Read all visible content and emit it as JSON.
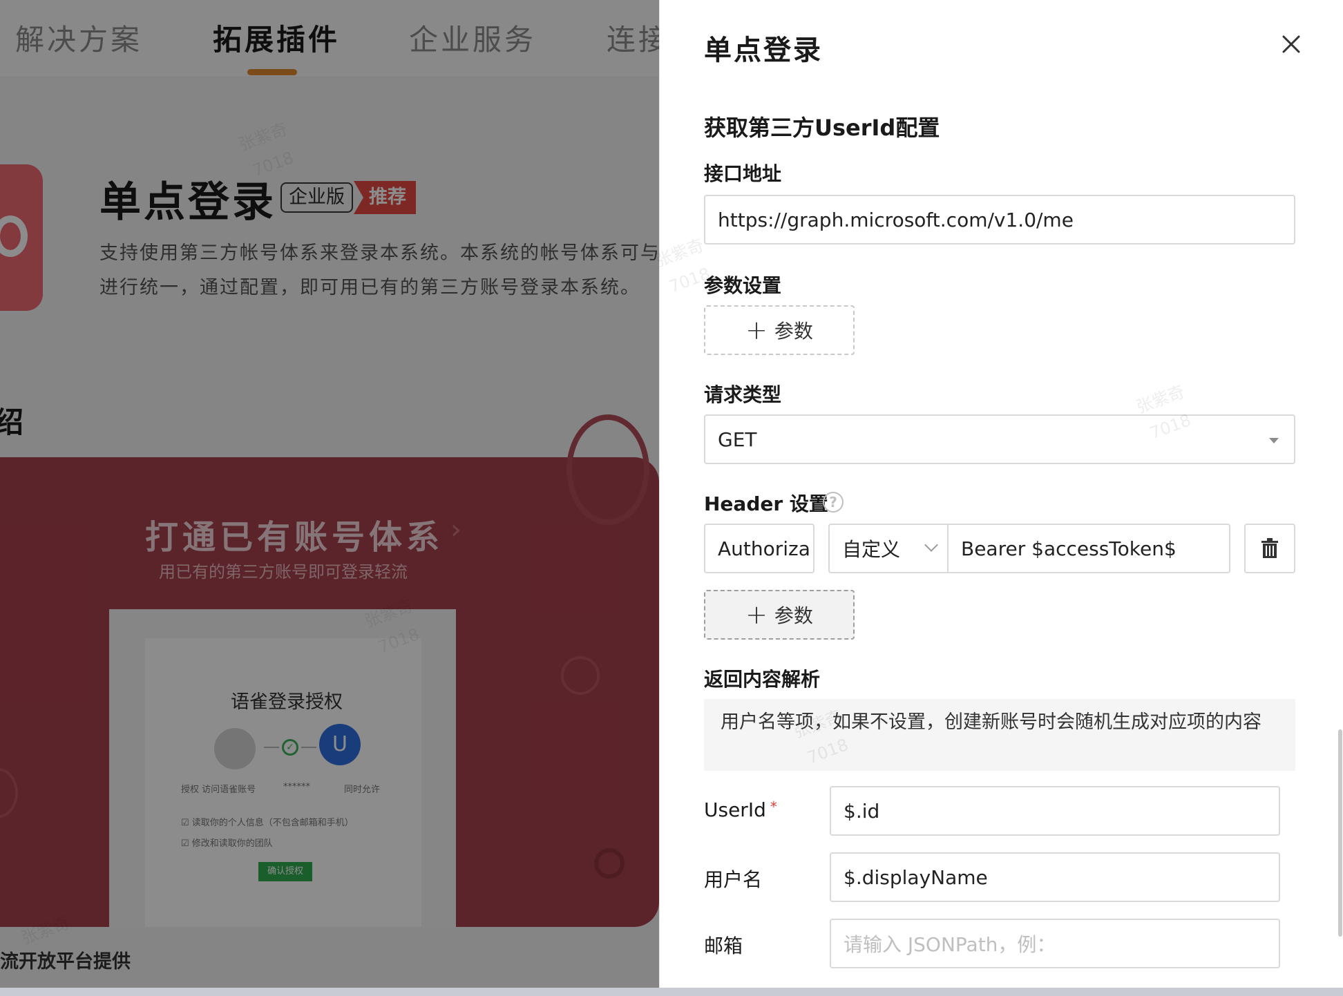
{
  "nav": {
    "tabs": [
      {
        "label": "解决方案"
      },
      {
        "label": "拓展插件"
      },
      {
        "label": "企业服务"
      },
      {
        "label": "连接"
      }
    ]
  },
  "plugin": {
    "title": "单点登录",
    "badge_enterprise": "企业版",
    "badge_recommend": "推荐",
    "description_line1": "支持使用第三方帐号体系来登录本系统。本系统的帐号体系可与",
    "description_line2": "进行统一，通过配置，即可用已有的第三方账号登录本系统。"
  },
  "intro": {
    "heading": "绍"
  },
  "banner": {
    "title": "打通已有账号体系",
    "subtitle": "用已有的第三方账号即可登录轻流",
    "mock": {
      "title": "语雀登录授权",
      "avatar_letter": "U",
      "caption_left": "授权 访问语雀账号",
      "caption_mid": "******",
      "caption_right": "同时允许",
      "check1": "读取你的个人信息（不包含邮箱和手机）",
      "check2": "修改和读取你的团队",
      "button": "确认授权"
    }
  },
  "footer": {
    "caption": "流开放平台提供"
  },
  "watermark": {
    "name": "张紫奇",
    "id": "7018"
  },
  "drawer": {
    "title": "单点登录",
    "section_title": "获取第三方UserId配置",
    "endpoint": {
      "label": "接口地址",
      "value": "https://graph.microsoft.com/v1.0/me"
    },
    "params": {
      "label": "参数设置",
      "add_label": "参数"
    },
    "method": {
      "label": "请求类型",
      "value": "GET"
    },
    "header": {
      "label": "Header 设置",
      "help_glyph": "?",
      "key": "Authoriza",
      "type": "自定义",
      "value": "Bearer $accessToken$",
      "add_label": "参数"
    },
    "response": {
      "label": "返回内容解析",
      "info": "用户名等项，如果不设置，创建新账号时会随机生成对应项的内容",
      "userid_label": "UserId",
      "required_mark": "*",
      "userid_value": "$.id",
      "username_label": "用户名",
      "username_value": "$.displayName",
      "email_label": "邮箱",
      "email_placeholder": "请输入 JSONPath，例："
    }
  }
}
